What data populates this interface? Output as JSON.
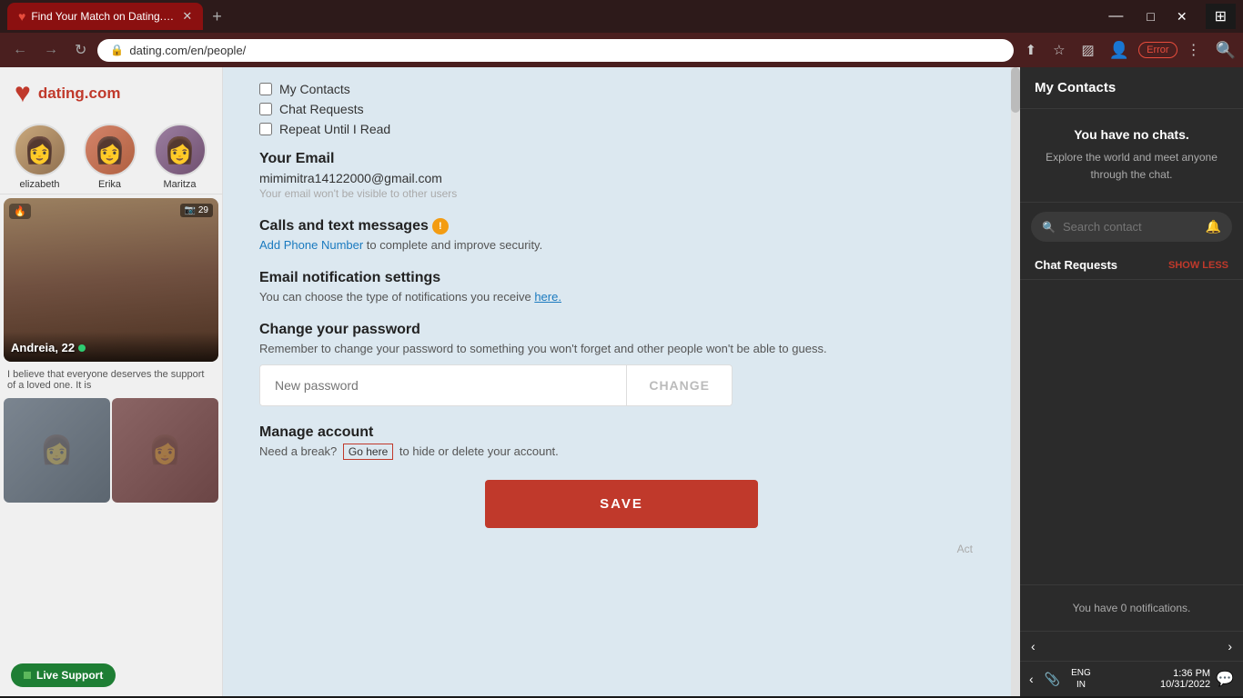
{
  "browser": {
    "tab_title": "Find Your Match on Dating.com:",
    "url": "dating.com/en/people/",
    "error_label": "Error",
    "window_controls": [
      "—",
      "□",
      "✕"
    ]
  },
  "logo": {
    "text": "dating.com"
  },
  "profiles": [
    {
      "name": "elizabeth"
    },
    {
      "name": "Erika"
    },
    {
      "name": "Maritza"
    }
  ],
  "feed_card": {
    "name": "Andreia, 22",
    "description": "I believe that everyone deserves the support of a loved one. It is",
    "photo_count": "29"
  },
  "modal": {
    "checkboxes": [
      {
        "label": "My Contacts"
      },
      {
        "label": "Chat Requests"
      },
      {
        "label": "Repeat Until I Read"
      }
    ],
    "email_section": {
      "title": "Your Email",
      "email": "mimimitra14122000@gmail.com",
      "note": "Your email won't be visible to other users"
    },
    "calls_section": {
      "title": "Calls and text messages",
      "link_text": "Add Phone Number",
      "link_suffix": " to complete and improve security."
    },
    "notifications_section": {
      "title": "Email notification settings",
      "text": "You can choose the type of notifications you receive ",
      "link": "here."
    },
    "password_section": {
      "title": "Change your password",
      "description": "Remember to change your password to something you won't forget and other people won't be able to guess.",
      "placeholder": "New password",
      "button_label": "CHANGE"
    },
    "manage_section": {
      "title": "Manage account",
      "text": "Need a break?",
      "link_text": "Go here",
      "link_suffix": " to hide or delete your account."
    },
    "save_button": "SAVE",
    "act_text": "Act"
  },
  "right_sidebar": {
    "title": "My Contacts",
    "no_chats_title": "You have no chats.",
    "no_chats_desc": "Explore the world and meet anyone through the chat.",
    "search_placeholder": "Search contact",
    "chat_requests_title": "Chat Requests",
    "show_less_label": "SHOW LESS",
    "notifications_text": "You have 0 notifications."
  },
  "taskbar": {
    "time": "1:36 PM",
    "date": "10/31/2022",
    "lang": "ENG\nIN"
  },
  "live_support": {
    "label": "Live Support"
  }
}
